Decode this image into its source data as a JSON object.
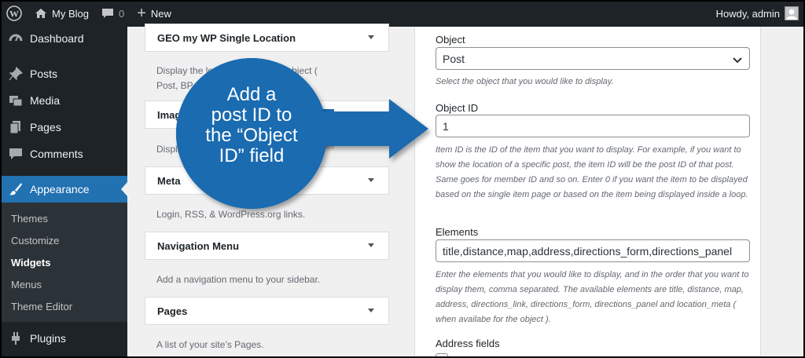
{
  "admin_bar": {
    "site_name": "My Blog",
    "comments_count": "0",
    "new_label": "New",
    "greeting": "Howdy, admin"
  },
  "sidebar": {
    "items": [
      {
        "label": "Dashboard",
        "icon": "dashboard-icon"
      },
      {
        "label": "Posts",
        "icon": "pin-icon"
      },
      {
        "label": "Media",
        "icon": "media-icon"
      },
      {
        "label": "Pages",
        "icon": "pages-icon"
      },
      {
        "label": "Comments",
        "icon": "comment-icon"
      },
      {
        "label": "Appearance",
        "icon": "brush-icon",
        "current": true
      },
      {
        "label": "Plugins",
        "icon": "plug-icon"
      }
    ],
    "submenu": [
      {
        "label": "Themes"
      },
      {
        "label": "Customize"
      },
      {
        "label": "Widgets",
        "active": true
      },
      {
        "label": "Menus"
      },
      {
        "label": "Theme Editor"
      }
    ]
  },
  "widgets": [
    {
      "title": "GEO my WP Single Location",
      "description": "Display the location of a single object ( Post, BP member..."
    },
    {
      "title": "Image",
      "description": "Displays an image."
    },
    {
      "title": "Meta",
      "description": "Login, RSS, & WordPress.org links."
    },
    {
      "title": "Navigation Menu",
      "description": "Add a navigation menu to your sidebar."
    },
    {
      "title": "Pages",
      "description": "A list of your site’s Pages."
    }
  ],
  "form": {
    "object_label": "Object",
    "object_value": "Post",
    "object_desc": "Select the object that you would like to display.",
    "object_id_label": "Object ID",
    "object_id_value": "1",
    "object_id_desc": "Item ID is the ID of the item that you want to display. For example, if you want to show the location of a specific post, the item ID will be the post ID of that post. Same goes for member ID and so on. Enter 0 if you want the item to be displayed based on the single item page or based on the item being displayed inside a loop.",
    "elements_label": "Elements",
    "elements_value": "title,distance,map,address,directions_form,directions_panel",
    "elements_desc": "Enter the elements that you would like to display, and in the order that you want to display them, comma separated. The available elements are title, distance, map, address, directions_link, directions_form, directions_panel and location_meta ( when availabe for the object ).",
    "address_fields_label": "Address fields"
  },
  "callout": {
    "text_lines": [
      "Add a",
      "post ID to",
      "the “Object",
      "ID” field"
    ],
    "color": "#1a6bb0"
  }
}
